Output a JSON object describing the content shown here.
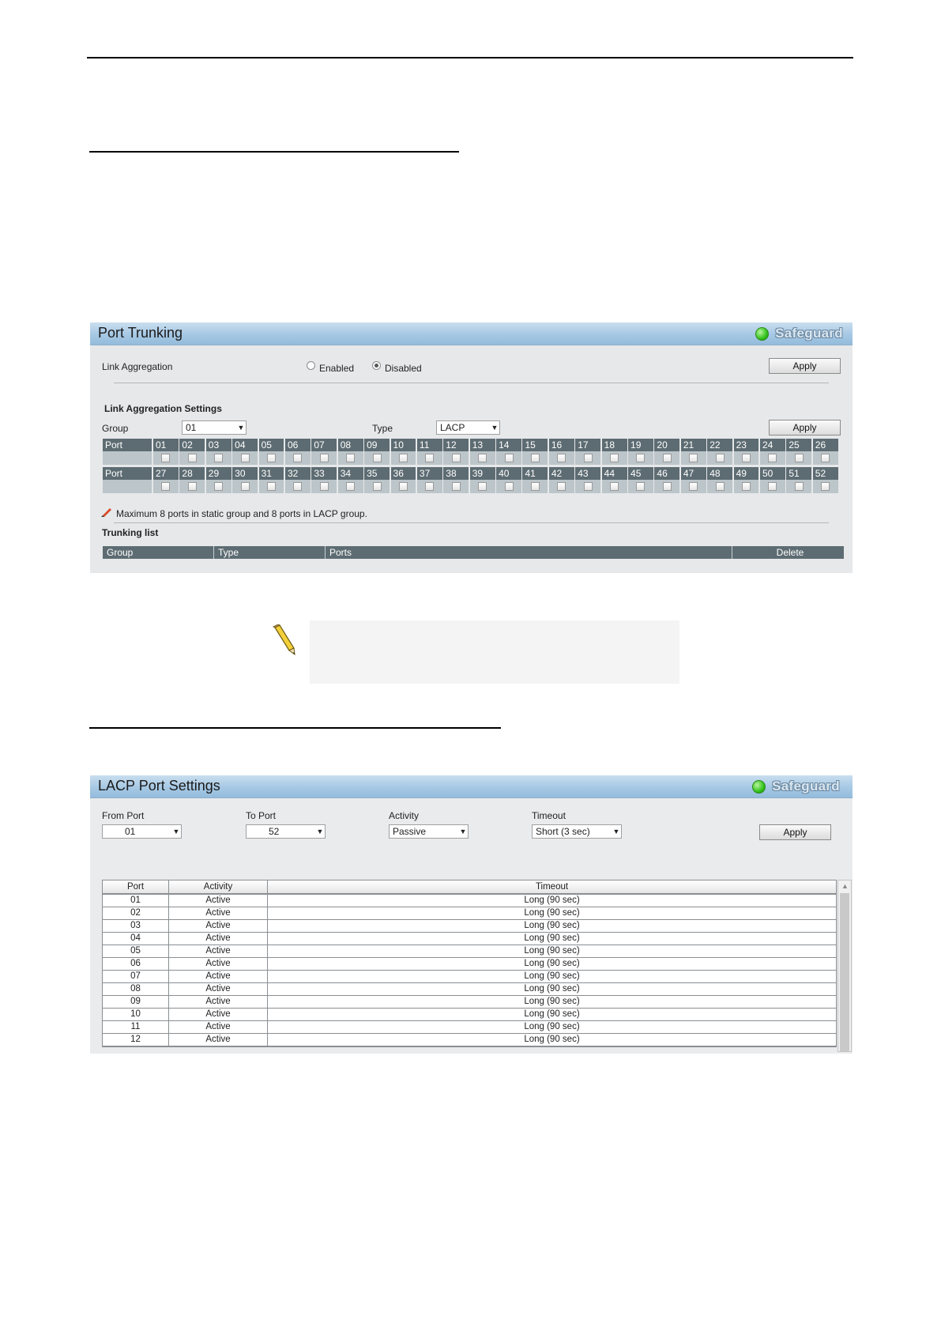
{
  "port_trunking": {
    "title": "Port Trunking",
    "safeguard": "Safeguard",
    "link_aggregation_label": "Link Aggregation",
    "enabled_label": "Enabled",
    "disabled_label": "Disabled",
    "link_aggregation_state": "Disabled",
    "apply1": "Apply",
    "settings_heading": "Link Aggregation Settings",
    "group_label": "Group",
    "group_value": "01",
    "type_label": "Type",
    "type_value": "LACP",
    "apply2": "Apply",
    "port_label": "Port",
    "ports_row1": [
      "01",
      "02",
      "03",
      "04",
      "05",
      "06",
      "07",
      "08",
      "09",
      "10",
      "11",
      "12",
      "13",
      "14",
      "15",
      "16",
      "17",
      "18",
      "19",
      "20",
      "21",
      "22",
      "23",
      "24",
      "25",
      "26"
    ],
    "ports_row2": [
      "27",
      "28",
      "29",
      "30",
      "31",
      "32",
      "33",
      "34",
      "35",
      "36",
      "37",
      "38",
      "39",
      "40",
      "41",
      "42",
      "43",
      "44",
      "45",
      "46",
      "47",
      "48",
      "49",
      "50",
      "51",
      "52"
    ],
    "note": "Maximum 8 ports in static group and 8 ports in LACP group.",
    "trunking_list_heading": "Trunking list",
    "list_columns": [
      "Group",
      "Type",
      "Ports",
      "Delete"
    ]
  },
  "lacp": {
    "title": "LACP Port Settings",
    "safeguard": "Safeguard",
    "from_port_label": "From Port",
    "from_port_value": "01",
    "to_port_label": "To Port",
    "to_port_value": "52",
    "activity_label": "Activity",
    "activity_value": "Passive",
    "timeout_label": "Timeout",
    "timeout_value": "Short (3 sec)",
    "apply": "Apply",
    "columns": [
      "Port",
      "Activity",
      "Timeout"
    ],
    "rows": [
      [
        "01",
        "Active",
        "Long (90 sec)"
      ],
      [
        "02",
        "Active",
        "Long (90 sec)"
      ],
      [
        "03",
        "Active",
        "Long (90 sec)"
      ],
      [
        "04",
        "Active",
        "Long (90 sec)"
      ],
      [
        "05",
        "Active",
        "Long (90 sec)"
      ],
      [
        "06",
        "Active",
        "Long (90 sec)"
      ],
      [
        "07",
        "Active",
        "Long (90 sec)"
      ],
      [
        "08",
        "Active",
        "Long (90 sec)"
      ],
      [
        "09",
        "Active",
        "Long (90 sec)"
      ],
      [
        "10",
        "Active",
        "Long (90 sec)"
      ],
      [
        "11",
        "Active",
        "Long (90 sec)"
      ],
      [
        "12",
        "Active",
        "Long (90 sec)"
      ]
    ]
  }
}
